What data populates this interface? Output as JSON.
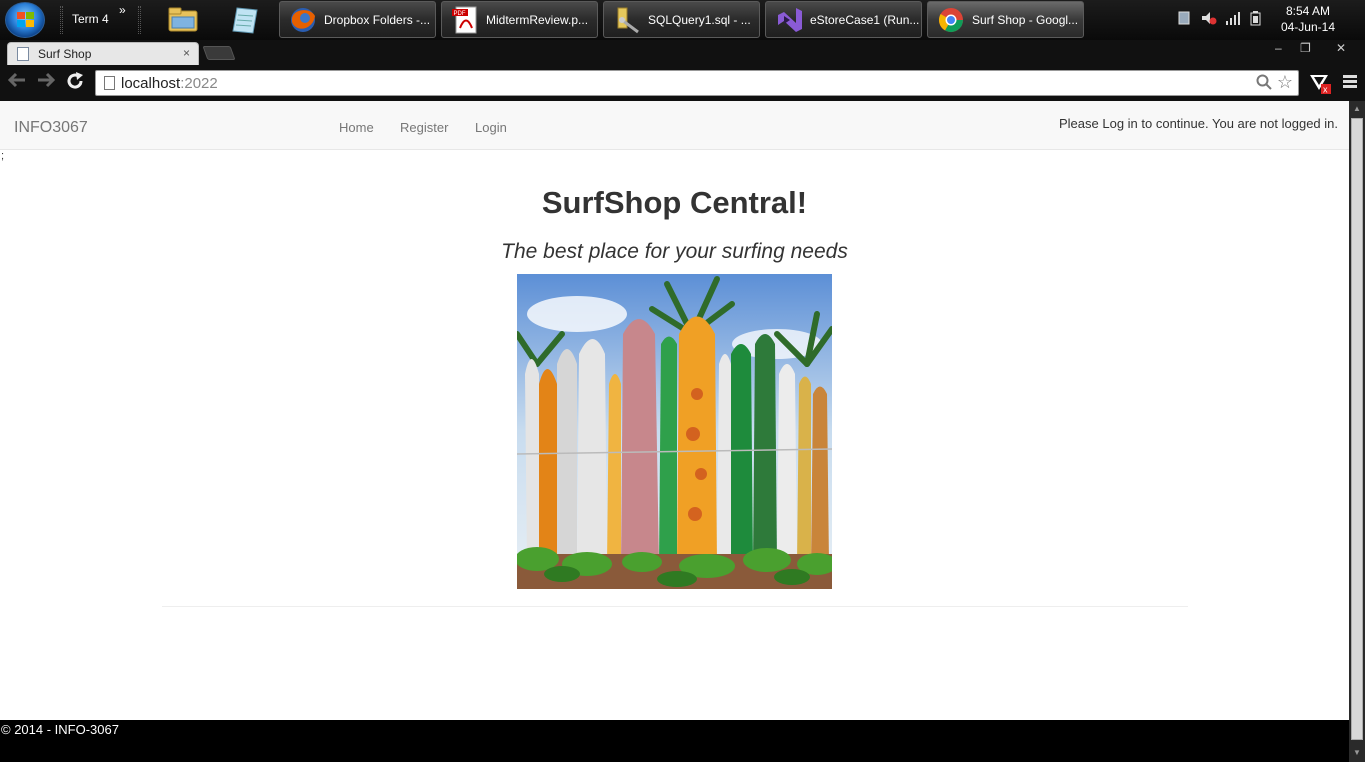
{
  "taskbar": {
    "term_label": "Term 4",
    "overflow_chevron": "»",
    "tasks": [
      {
        "label": "Dropbox Folders -..."
      },
      {
        "label": "MidtermReview.p..."
      },
      {
        "label": "SQLQuery1.sql - ..."
      },
      {
        "label": "eStoreCase1 (Run..."
      },
      {
        "label": "Surf Shop - Googl..."
      }
    ],
    "pdf_badge": "PDF",
    "clock_time": "8:54 AM",
    "clock_date": "04-Jun-14"
  },
  "browser": {
    "tab_title": "Surf Shop",
    "tab_close": "×",
    "url_host": "localhost",
    "url_port": ":2022",
    "window_controls": {
      "minimize": "‒",
      "restore": "❐",
      "close": "✕"
    }
  },
  "page": {
    "brand": "INFO3067",
    "nav": [
      {
        "label": "Home"
      },
      {
        "label": "Register"
      },
      {
        "label": "Login"
      }
    ],
    "login_message": "Please Log in to continue. You are not logged in.",
    "stray_text": ";",
    "heading": "SurfShop Central!",
    "tagline": "The best place for your surfing needs",
    "footer": "© 2014 - INFO-3067"
  },
  "icons": {
    "start": "windows-start-orb",
    "explorer": "folder-icon",
    "notepad": "notepad-icon",
    "firefox": "firefox-icon",
    "pdf": "pdf-icon",
    "sql": "sql-query-icon",
    "vs": "visual-studio-icon",
    "chrome": "chrome-icon"
  }
}
